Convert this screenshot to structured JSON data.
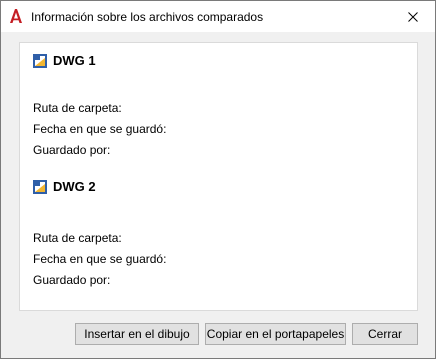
{
  "window": {
    "title": "Información sobre los archivos comparados",
    "close_glyph": "✕",
    "app_icon": "autocad-a-icon"
  },
  "dwg1": {
    "title": "DWG 1",
    "icon": "dwg-file-icon",
    "folder_label": "Ruta de carpeta:",
    "saved_label": "Fecha en que se guardó:",
    "saved_by_label": "Guardado por:"
  },
  "dwg2": {
    "title": "DWG 2",
    "icon": "dwg-file-icon",
    "folder_label": "Ruta de carpeta:",
    "saved_label": "Fecha en que se guardó:",
    "saved_by_label": "Guardado por:"
  },
  "buttons": {
    "insert": "Insertar en el dibujo",
    "copy": "Copiar en el portapapeles",
    "close": "Cerrar"
  },
  "colors": {
    "app_icon": "#c41e24",
    "dwg_icon_blue": "#2f5fa8",
    "dwg_icon_yellow": "#f2b632"
  }
}
